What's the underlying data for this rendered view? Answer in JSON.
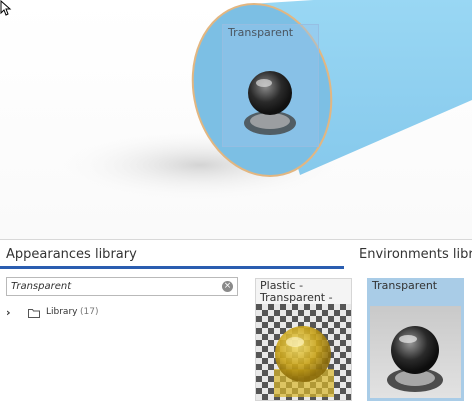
{
  "viewport": {
    "drag_preview": {
      "label": "Transparent"
    }
  },
  "appearances": {
    "title": "Appearances library",
    "search": {
      "value": "Transparent",
      "placeholder": ""
    },
    "tree": [
      {
        "label": "Library",
        "count": "(17)"
      }
    ],
    "tiles": [
      {
        "label": "Plastic - Transparent -"
      }
    ]
  },
  "environments": {
    "title": "Environments library",
    "tiles": [
      {
        "label": "Transparent",
        "selected": true
      }
    ]
  },
  "colors": {
    "cylinder": "#8fd0f0",
    "cylinder_edge": "#e2b681",
    "tab_underline": "#2a5db0",
    "selection": "#a9cce7"
  }
}
